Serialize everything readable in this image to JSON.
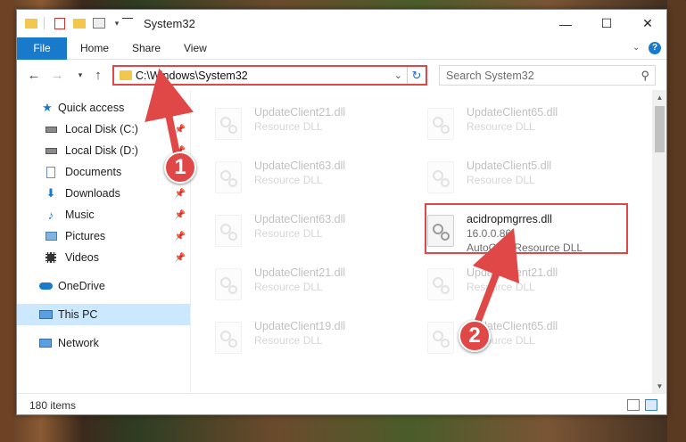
{
  "window": {
    "title": "System32",
    "minimize": "—",
    "maximize": "☐",
    "close": "✕"
  },
  "ribbon": {
    "tabs": [
      "File",
      "Home",
      "Share",
      "View"
    ]
  },
  "address": {
    "path": "C:\\Windows\\System32",
    "search_placeholder": "Search System32"
  },
  "nav": {
    "items": [
      {
        "label": "Quick access",
        "icon": "star-icon"
      },
      {
        "label": "Local Disk (C:)",
        "icon": "drive-icon",
        "pinned": true
      },
      {
        "label": "Local Disk (D:)",
        "icon": "drive-icon",
        "pinned": true
      },
      {
        "label": "Documents",
        "icon": "documents-icon",
        "pinned": true
      },
      {
        "label": "Downloads",
        "icon": "downloads-icon",
        "pinned": true
      },
      {
        "label": "Music",
        "icon": "music-icon",
        "pinned": true
      },
      {
        "label": "Pictures",
        "icon": "pictures-icon",
        "pinned": true
      },
      {
        "label": "Videos",
        "icon": "videos-icon",
        "pinned": true
      },
      {
        "label": "OneDrive",
        "icon": "onedrive-icon"
      },
      {
        "label": "This PC",
        "icon": "computer-icon",
        "selected": true
      },
      {
        "label": "Network",
        "icon": "network-icon"
      }
    ]
  },
  "files": [
    {
      "name": "UpdateClient21.dll",
      "desc": "Resource DLL"
    },
    {
      "name": "UpdateClient65.dll",
      "desc": "Resource DLL"
    },
    {
      "name": "UpdateClient63.dll",
      "desc": "Resource DLL"
    },
    {
      "name": "UpdateClient5.dll",
      "desc": "Resource DLL"
    },
    {
      "name": "UpdateClient63.dll",
      "desc": "Resource DLL"
    },
    {
      "name": "acidropmgrres.dll",
      "version": "16.0.0.86",
      "desc": "AutoCAD Resource DLL",
      "highlighted": true
    },
    {
      "name": "UpdateClient21.dll",
      "desc": "Resource DLL"
    },
    {
      "name": "UpdateClient21.dll",
      "desc": "Resource DLL"
    },
    {
      "name": "UpdateClient19.dll",
      "desc": "Resource DLL"
    },
    {
      "name": "UpdateClient65.dll",
      "desc": "Resource DLL"
    }
  ],
  "status": {
    "item_count": "180 items"
  },
  "callouts": [
    "1",
    "2"
  ],
  "colors": {
    "accent": "#1979ca",
    "highlight_red": "#e04848",
    "selection": "#cce8ff"
  }
}
